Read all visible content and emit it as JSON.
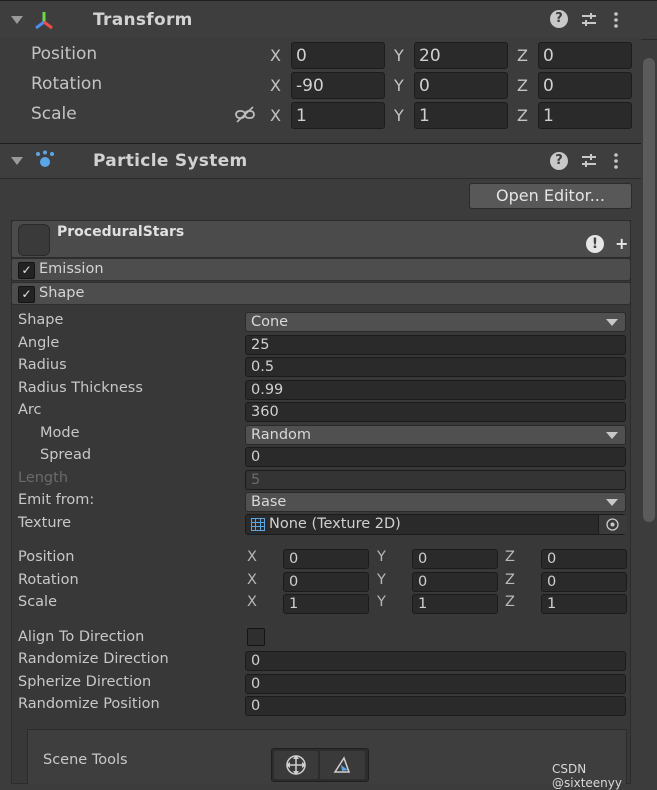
{
  "transform": {
    "title": "Transform",
    "rows": [
      {
        "label": "Position",
        "x": "0",
        "y": "20",
        "z": "0"
      },
      {
        "label": "Rotation",
        "x": "-90",
        "y": "0",
        "z": "0"
      },
      {
        "label": "Scale",
        "x": "1",
        "y": "1",
        "z": "1"
      }
    ],
    "axes": {
      "x": "X",
      "y": "Y",
      "z": "Z"
    }
  },
  "particle_system": {
    "title": "Particle System",
    "open_editor_label": "Open Editor...",
    "system_name": "ProceduralStars",
    "modules": [
      {
        "label": "Emission",
        "checked": true
      },
      {
        "label": "Shape",
        "checked": true
      }
    ]
  },
  "shape_module": {
    "shape": {
      "label": "Shape",
      "value": "Cone"
    },
    "angle": {
      "label": "Angle",
      "value": "25"
    },
    "radius": {
      "label": "Radius",
      "value": "0.5"
    },
    "radius_thickness": {
      "label": "Radius Thickness",
      "value": "0.99"
    },
    "arc": {
      "label": "Arc",
      "value": "360"
    },
    "mode": {
      "label": "Mode",
      "value": "Random"
    },
    "spread": {
      "label": "Spread",
      "value": "0"
    },
    "length": {
      "label": "Length",
      "value": "5"
    },
    "emit_from": {
      "label": "Emit from:",
      "value": "Base"
    },
    "texture": {
      "label": "Texture",
      "value": "None (Texture 2D)"
    },
    "position": {
      "label": "Position",
      "x": "0",
      "y": "0",
      "z": "0"
    },
    "rotation": {
      "label": "Rotation",
      "x": "0",
      "y": "0",
      "z": "0"
    },
    "scale": {
      "label": "Scale",
      "x": "1",
      "y": "1",
      "z": "1"
    },
    "align_to_direction": {
      "label": "Align To Direction",
      "checked": false
    },
    "randomize_direction": {
      "label": "Randomize Direction",
      "value": "0"
    },
    "spherize_direction": {
      "label": "Spherize Direction",
      "value": "0"
    },
    "randomize_position": {
      "label": "Randomize Position",
      "value": "0"
    },
    "scene_tools_label": "Scene Tools"
  },
  "watermark": "CSDN @sixteenyy",
  "colors": {
    "background": "#3c3c3c",
    "field": "#2a2a2a",
    "header": "#3e3e3e",
    "module": "#4d4d4d"
  }
}
